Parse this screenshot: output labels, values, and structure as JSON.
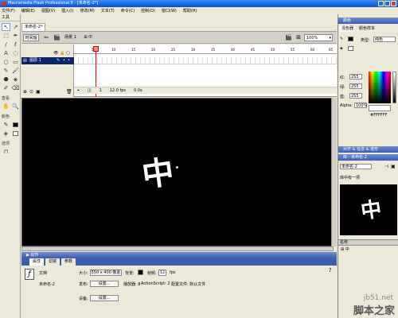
{
  "window": {
    "title": "Macromedia Flash Professional 8 - [未命名-2*]"
  },
  "menu": [
    "文件(F)",
    "编辑(E)",
    "视图(V)",
    "插入(I)",
    "修改(M)",
    "文本(T)",
    "命令(C)",
    "控制(O)",
    "窗口(W)",
    "帮助(H)"
  ],
  "tools": {
    "header": "工具",
    "icons": [
      "↖",
      "↗",
      "⬚",
      "✒",
      "/",
      "ℓ",
      "A",
      "◌",
      "○",
      "▭",
      "✎",
      "🖌",
      "⬣",
      "◈",
      "✐",
      "⌫"
    ],
    "view_label": "查看",
    "view_icons": [
      "✋",
      "🔍"
    ],
    "color_label": "颜色",
    "options_label": "选项"
  },
  "document": {
    "tab": "未命名-2*",
    "scene_button": "时间轴",
    "breadcrumb_scene": "场景 1",
    "breadcrumb_symbol": "中",
    "zoom": "100%"
  },
  "timeline": {
    "layer": "图层 1",
    "ruler": [
      "5",
      "10",
      "15",
      "20",
      "25",
      "30",
      "35",
      "40",
      "45",
      "50",
      "55",
      "60",
      "65"
    ],
    "current_frame": "1",
    "fps": "12.0 fps",
    "elapsed": "0.0s"
  },
  "stage": {
    "text": "中"
  },
  "actions_bar": "▶ 动作",
  "props": {
    "tabs": [
      "属性",
      "滤镜",
      "参数"
    ],
    "doc_label": "文档",
    "doc_name": "未命名-2",
    "size_label": "大小:",
    "size_value": "550 x 400 像素",
    "bg_label": "背景:",
    "fps_label": "帧频:",
    "fps_value": "12",
    "fps_unit": "fps",
    "publish_label": "发布:",
    "settings_button": "设置...",
    "player_label": "播放器: 8",
    "as_label": "ActionScript: 2",
    "profile_label": "配置文件: 默认文件",
    "device_label": "设备:",
    "device_button": "设置..."
  },
  "right_panel": {
    "color_header": "颜色",
    "color_tabs": [
      "混色器",
      "颜色样本"
    ],
    "type_label": "类型:",
    "type_value": "纯色",
    "r_label": "红:",
    "r_value": "255",
    "g_label": "绿:",
    "g_value": "255",
    "b_label": "蓝:",
    "b_value": "255",
    "alpha_label": "Alpha:",
    "alpha_value": "100%",
    "hex_value": "#FFFFFF",
    "align_header": "对齐 & 信息 & 变形",
    "library_header": "库 - 未命名-2",
    "library_doc": "未命名-2",
    "library_count": "库中有一项",
    "name_col": "名称",
    "library_item": "中"
  },
  "watermark": {
    "site": "jb51.net",
    "brand": "脚本之家"
  }
}
